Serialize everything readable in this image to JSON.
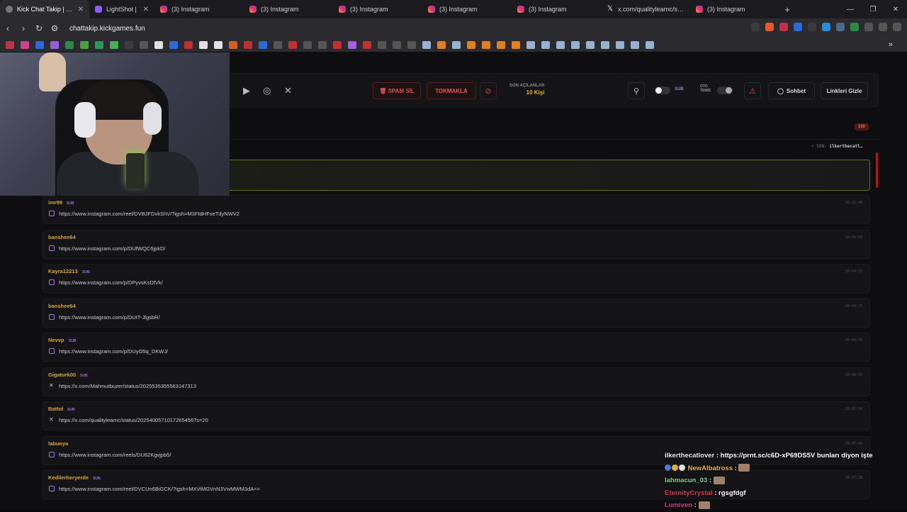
{
  "browser": {
    "tabs": [
      {
        "title": "Kick Chat Takip | Wich",
        "icon": "kick-icon",
        "active": true
      },
      {
        "title": "LightShot |",
        "icon": "lightshot-icon"
      },
      {
        "title": "(3) Instagram",
        "icon": "instagram-icon"
      },
      {
        "title": "(3) Instagram",
        "icon": "instagram-icon"
      },
      {
        "title": "(3) Instagram",
        "icon": "instagram-icon"
      },
      {
        "title": "(3) Instagram",
        "icon": "instagram-icon"
      },
      {
        "title": "(3) Instagram",
        "icon": "instagram-icon"
      },
      {
        "title": "x.com/qualitylearnc/status",
        "icon": "x-icon"
      },
      {
        "title": "(3) Instagram",
        "icon": "instagram-icon"
      }
    ],
    "url": "chattakip.kickgames.fun"
  },
  "toolbar": {
    "spam_label": "SPAM SİL",
    "tokmakla_label": "TOKMAKLA",
    "son_label_1": "SON AÇILANLAR",
    "son_count": "10 Kişi",
    "sub_label": "SUB",
    "oto_label_1": "OTO",
    "oto_label_2": "TEMİZ",
    "sohbet_label": "Sohbet",
    "linkleri_label": "Linkleri Gizle"
  },
  "counter": "100",
  "last": {
    "label": "SON:",
    "name": "ilkerthecatl…"
  },
  "messages": [
    {
      "user": "imr99",
      "sub": "SUB",
      "link": "https://www.instagram.com/reel/DVBJFDvkShV/?igsh=M3FtdHFxeTdyNWV2",
      "type": "ig",
      "time": "20:11:30"
    },
    {
      "user": "banshee64",
      "sub": "",
      "link": "https://www.instagram.com/p/DUfWQC6jpkD/",
      "type": "ig",
      "time": "20:10:03"
    },
    {
      "user": "Kayra12213",
      "sub": "SUB",
      "link": "https://www.instagram.com/p/DPyvsKsDfVk/",
      "type": "ig",
      "time": "20:09:25"
    },
    {
      "user": "banshee64",
      "sub": "",
      "link": "https://www.instagram.com/p/DUIT-JlgsbR/",
      "type": "ig",
      "time": "20:09:25"
    },
    {
      "user": "Nevvp",
      "sub": "SUB",
      "link": "https://www.instagram.com/p/DUyO5q_DKWJ/",
      "type": "ig",
      "time": "20:09:25"
    },
    {
      "user": "Gigaturk00",
      "sub": "SUB",
      "link": "https://x.com/Mahmutbuzer/status/2025535355563147313",
      "type": "x",
      "time": "20:08:15"
    },
    {
      "user": "Battol",
      "sub": "SUB",
      "link": "https://x.com/qualitylearnc/status/2025400571017265456?s=20",
      "type": "x",
      "time": "20:07:54"
    },
    {
      "user": "labunya",
      "sub": "",
      "link": "https://www.instagram.com/reels/DU82Kgvjpb5/",
      "type": "ig",
      "time": "20:07:49"
    },
    {
      "user": "Kedilerheryerde",
      "sub": "SUB",
      "link": "https://www.instagram.com/reel/DVCUn6BiGCK/?igsh=MXViMGVnN3VwMWM3dA==",
      "type": "ig",
      "time": "20:07:38"
    }
  ],
  "overlay_chat": [
    {
      "user": "ilkerthecatlover",
      "color": "#e8e8e8",
      "text": " : https://prnt.sc/c6D-xP69DS5V bunları diyon işte"
    },
    {
      "user": "NewAlbatross",
      "color": "#e5b64a",
      "text": " : "
    },
    {
      "user": "lahmacun_03",
      "color": "#78d39a",
      "text": " : "
    },
    {
      "user": "EternityCrystal",
      "color": "#d83a5a",
      "text": " : rgsgfdgf"
    },
    {
      "user": "Lumiven",
      "color": "#c2458a",
      "text": " : "
    }
  ]
}
